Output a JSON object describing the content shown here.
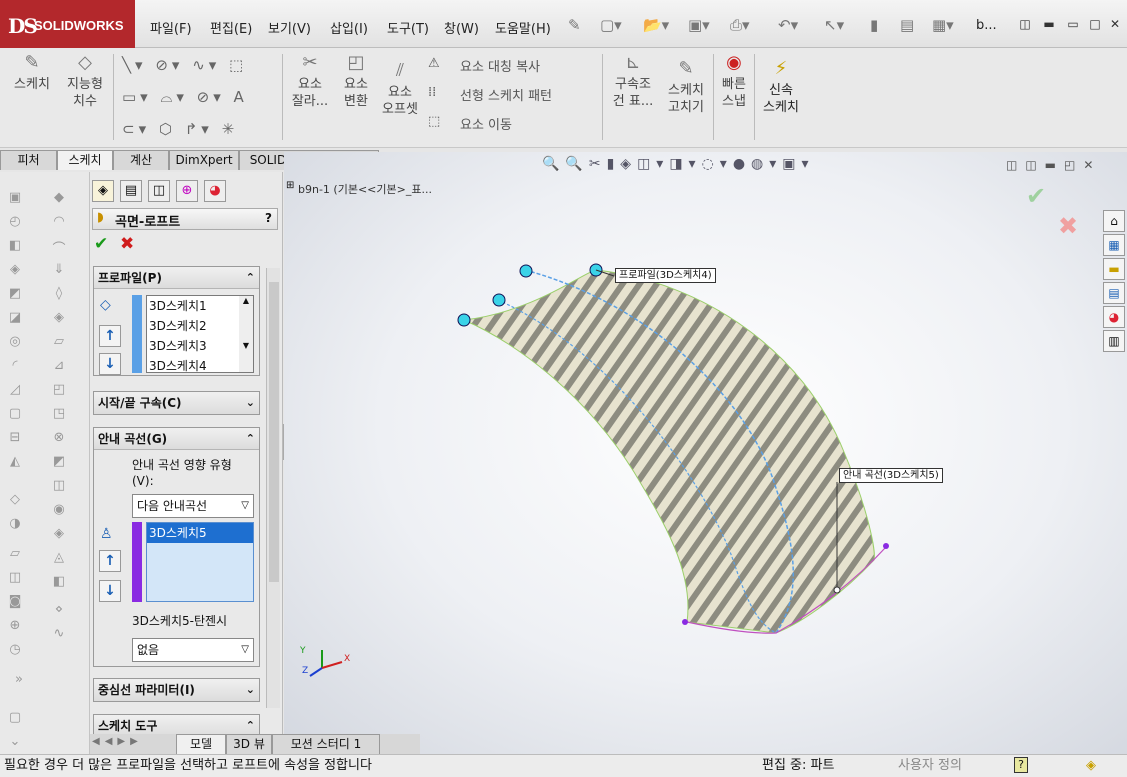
{
  "app": {
    "logo_ds": "DS",
    "logo_text": "SOLIDWORKS"
  },
  "menu": [
    "파일(F)",
    "편집(E)",
    "보기(V)",
    "삽입(I)",
    "도구(T)",
    "창(W)",
    "도움말(H)"
  ],
  "title_doc": "b...",
  "commands": {
    "sketch": "스케치",
    "smart_dim_1": "지능형",
    "smart_dim_2": "치수",
    "trim_1": "요소",
    "trim_2": "잘라...",
    "convert_1": "요소",
    "convert_2": "변환",
    "offset_1": "요소",
    "offset_2": "오프셋",
    "mirror": "요소 대칭 복사",
    "pattern": "선형 스케치 패턴",
    "move": "요소 이동",
    "relations_1": "구속조",
    "relations_2": "건 표...",
    "repair_1": "스케치",
    "repair_2": "고치기",
    "snap_1": "빠른",
    "snap_2": "스냅",
    "rapid_1": "신속",
    "rapid_2": "스케치"
  },
  "tabs": [
    "피처",
    "스케치",
    "계산",
    "DimXpert",
    "SOLIDWORKS 애드인"
  ],
  "active_tab": "스케치",
  "pm": {
    "title": "곡면-로프트",
    "help": "?",
    "profile_head": "프로파일(P)",
    "profiles": [
      "3D스케치1",
      "3D스케치2",
      "3D스케치3",
      "3D스케치4"
    ],
    "start_end_head": "시작/끝 구속(C)",
    "guide_head": "안내 곡선(G)",
    "guide_influence_label_1": "안내 곡선 영향 유형",
    "guide_influence_label_2": "(V):",
    "guide_influence_value": "다음 안내곡선",
    "guides": [
      "3D스케치5"
    ],
    "tangent_label": "3D스케치5-탄젠시",
    "tangent_value": "없음",
    "centerline_head": "중심선 파라미터(I)",
    "sketch_tools_head": "스케치 도구"
  },
  "tree_root": "b9n-1  (기본<<기본>_표...",
  "callouts": {
    "profile": "프로파일(3D스케치4)",
    "guide": "안내 곡선(3D스케치5)"
  },
  "axes": {
    "x": "X",
    "y": "Y",
    "z": "Z"
  },
  "bottom_tabs": [
    "모델",
    "3D 뷰",
    "모션 스터디 1"
  ],
  "status": {
    "message": "필요한 경우 더 많은 프로파일을 선택하고 로프트에 속성을 정합니다",
    "editing": "편집 중: 파트",
    "custom": "사용자 정의"
  },
  "colors": {
    "brand": "#b3282c",
    "selection": "#1e6fd0",
    "guide_bar": "#8a2be2",
    "profile_bar": "#5aa0e6"
  }
}
